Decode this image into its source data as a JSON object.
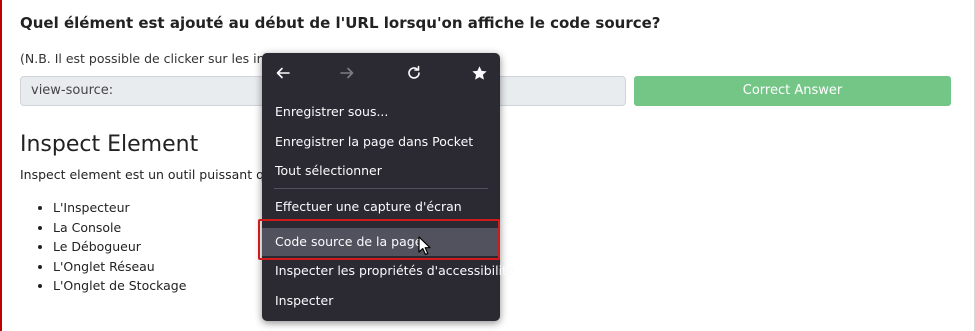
{
  "question": "Quel élément est ajouté au début de l'URL lorsqu'on affiche le code source?",
  "note": "(N.B. Il est possible de clicker sur les images",
  "answer": {
    "value": "view-source:"
  },
  "correct_button": "Correct Answer",
  "section": {
    "title": "Inspect Element",
    "description": "Inspect element est un outil puissant qui n"
  },
  "tools": [
    "L'Inspecteur",
    "La Console",
    "Le Débogueur",
    "L'Onglet Réseau",
    "L'Onglet de Stockage"
  ],
  "context_menu": {
    "nav_icons": [
      "back-arrow-icon",
      "forward-arrow-icon",
      "reload-icon",
      "bookmark-star-icon"
    ],
    "items": [
      "Enregistrer sous...",
      "Enregistrer la page dans Pocket",
      "Tout sélectionner",
      "Effectuer une capture d'écran",
      "Code source de la page",
      "Inspecter les propriétés d'accessibilité",
      "Inspecter"
    ],
    "highlighted_item": "Code source de la page"
  },
  "colors": {
    "accent_red": "#c00000",
    "highlight_box": "#d11a1a",
    "button_green": "#74c687",
    "menu_bg": "#2b2a33"
  }
}
